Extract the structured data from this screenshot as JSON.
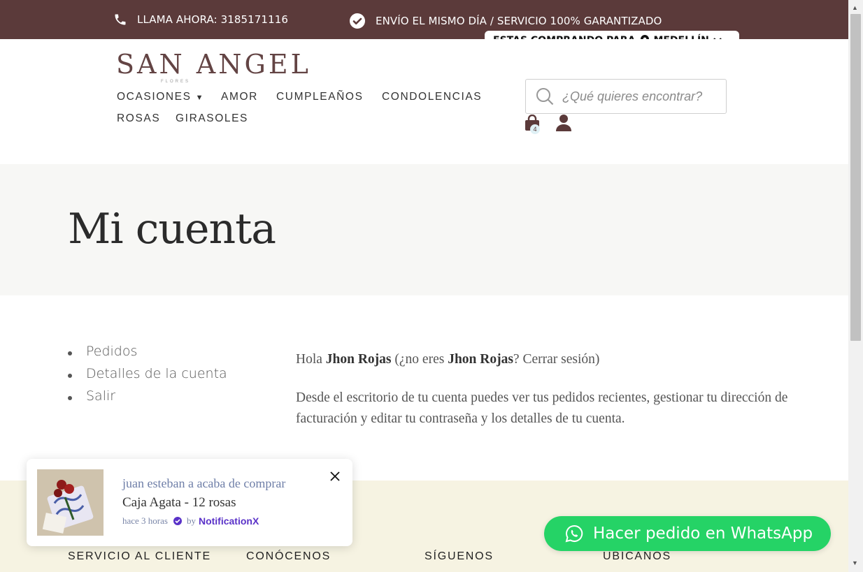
{
  "topbar": {
    "phone_text": "LLAMA AHORA: 3185171116",
    "shipping_text": "ENVÍO EL MISMO DÍA / SERVICIO 100% GARANTIZADO",
    "bg_color": "#5b3a3a"
  },
  "location": {
    "label": "ESTAS COMPRANDO PARA",
    "city": "MEDELLÍN"
  },
  "logo": {
    "text": "SAN ANGEL",
    "subtitle": "FLORES"
  },
  "nav": {
    "items": [
      {
        "label": "OCASIONES"
      },
      {
        "label": "AMOR"
      },
      {
        "label": "CUMPLEAÑOS"
      },
      {
        "label": "CONDOLENCIAS"
      },
      {
        "label": "ROSAS"
      },
      {
        "label": "GIRASOLES"
      }
    ]
  },
  "search": {
    "placeholder": "¿Qué quieres encontrar?",
    "value": ""
  },
  "cart": {
    "count": "4"
  },
  "hero": {
    "title": "Mi cuenta"
  },
  "account_nav": {
    "items": [
      {
        "label": "Pedidos"
      },
      {
        "label": "Detalles de la cuenta"
      },
      {
        "label": "Salir"
      }
    ]
  },
  "content": {
    "greeting_prefix": "Hola ",
    "user_name": "Jhon Rojas",
    "not_you_prefix": " (¿no eres ",
    "user_name_2": "Jhon Rojas",
    "not_you_suffix": "? ",
    "logout_link": "Cerrar sesión",
    "close_paren": ")",
    "description": "Desde el escritorio de tu cuenta puedes ver tus pedidos recientes, gestionar tu dirección de facturación y editar tu contraseña y los detalles de tu cuenta."
  },
  "footer": {
    "columns": [
      "SERVICIO AL CLIENTE",
      "CONÓCENOS",
      "SÍGUENOS",
      "UBÍCANOS"
    ]
  },
  "notification": {
    "buyer_text": "juan esteban a acaba de comprar",
    "product": "Caja Agata - 12 rosas",
    "time": "hace 3 horas",
    "by": "by",
    "brand": "NotificationX"
  },
  "whatsapp": {
    "label": "Hacer pedido en WhatsApp",
    "color": "#25d366"
  }
}
